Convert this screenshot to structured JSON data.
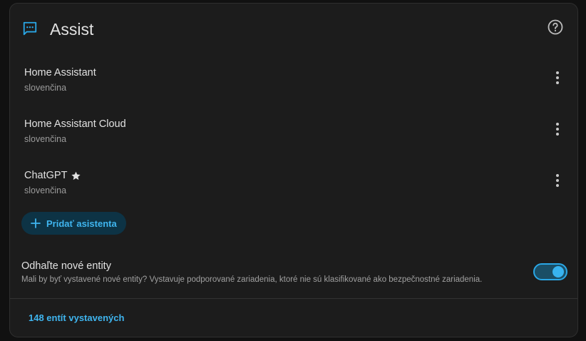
{
  "header": {
    "title": "Assist",
    "icon": "chat-bubble-icon",
    "help_icon": "help-circle-icon"
  },
  "pipelines": [
    {
      "name": "Home Assistant",
      "language": "slovenčina",
      "preferred": false
    },
    {
      "name": "Home Assistant Cloud",
      "language": "slovenčina",
      "preferred": false
    },
    {
      "name": "ChatGPT",
      "language": "slovenčina",
      "preferred": true
    }
  ],
  "add_button": {
    "label": "Pridať asistenta",
    "icon": "plus-icon"
  },
  "expose": {
    "title": "Odhaľte nové entity",
    "description": "Mali by byť vystavené nové entity? Vystavuje podporované zariadenia, ktoré nie sú klasifikované ako bezpečnostné zariadenia.",
    "enabled": true
  },
  "footer": {
    "link": "148 entít vystavených"
  },
  "colors": {
    "accent": "#3fb5ef",
    "card_background": "#1c1c1c",
    "primary_text": "#e1e1e1",
    "secondary_text": "#9b9b9b"
  }
}
